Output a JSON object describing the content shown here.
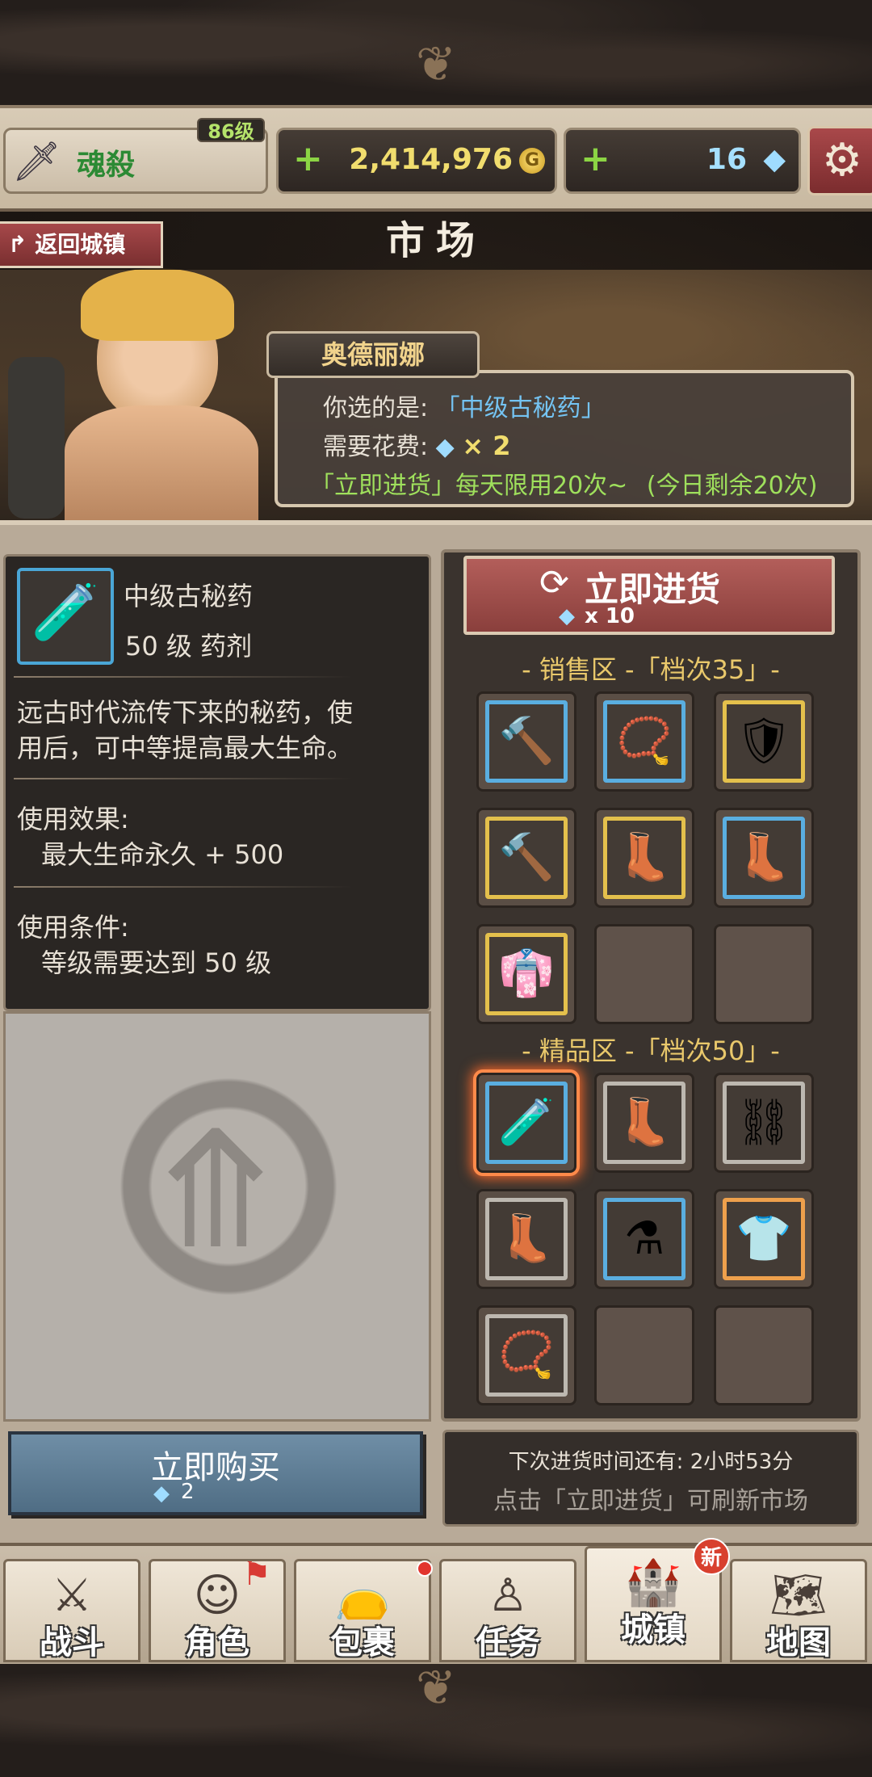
{
  "player": {
    "name": "魂殺",
    "level": "86级"
  },
  "currency": {
    "gold": "2,414,976",
    "gems": "16",
    "plus": "+"
  },
  "header": {
    "title": "市场",
    "back_label": "返回城镇"
  },
  "npc": {
    "name": "奥德丽娜",
    "line1_label": "你选的是:",
    "line1_value": "「中级古秘药」",
    "line2_label": "需要花费:",
    "line2_value": "× 2",
    "line3": "「立即进货」每天限用20次~",
    "line3_remaining": "(今日剩余20次)"
  },
  "item": {
    "name": "中级古秘药",
    "type": "50 级 药剂",
    "desc_line1": "远古时代流传下来的秘药，使",
    "desc_line2": "用后，可中等提高最大生命。",
    "effect_title": "使用效果:",
    "effect_value": "最大生命永久 + 500",
    "cond_title": "使用条件:",
    "cond_value": "等级需要达到 50 级"
  },
  "restock": {
    "label": "立即进货",
    "cost": "x 10"
  },
  "sale_zone": {
    "title": "- 销售区 -「档次35」-",
    "slots": [
      {
        "icon": "mace",
        "quality": "blue"
      },
      {
        "icon": "amulet",
        "quality": "blue"
      },
      {
        "icon": "armor",
        "quality": "gold"
      },
      {
        "icon": "mace",
        "quality": "gold"
      },
      {
        "icon": "boots",
        "quality": "gold"
      },
      {
        "icon": "boots",
        "quality": "blue"
      },
      {
        "icon": "robe",
        "quality": "gold"
      },
      {
        "icon": "",
        "quality": "empty"
      },
      {
        "icon": "",
        "quality": "empty"
      }
    ]
  },
  "premium_zone": {
    "title": "- 精品区 -「档次50」-",
    "slots": [
      {
        "icon": "potion-red",
        "quality": "blue"
      },
      {
        "icon": "boots",
        "quality": "gray"
      },
      {
        "icon": "belt",
        "quality": "gray"
      },
      {
        "icon": "boots",
        "quality": "gray"
      },
      {
        "icon": "potion-brown",
        "quality": "blue"
      },
      {
        "icon": "shirt",
        "quality": "orange"
      },
      {
        "icon": "amulet",
        "quality": "gray"
      },
      {
        "icon": "",
        "quality": "empty"
      },
      {
        "icon": "",
        "quality": "empty"
      }
    ]
  },
  "buy": {
    "label": "立即购买",
    "cost": "2"
  },
  "timer": {
    "line1": "下次进货时间还有:  2小时53分",
    "line2": "点击「立即进货」可刷新市场"
  },
  "nav": [
    {
      "label": "战斗",
      "icon": "crossed-swords"
    },
    {
      "label": "角色",
      "icon": "character-face"
    },
    {
      "label": "包裹",
      "icon": "bag"
    },
    {
      "label": "任务",
      "icon": "quest-figure"
    },
    {
      "label": "城镇",
      "icon": "castle"
    },
    {
      "label": "地图",
      "icon": "map"
    }
  ],
  "nav_badge_new": "新",
  "colors": {
    "accent_red": "#8a3f3c",
    "gold": "#f1dd6e",
    "blue_text": "#74c3f2",
    "green_text": "#9fe05c"
  }
}
